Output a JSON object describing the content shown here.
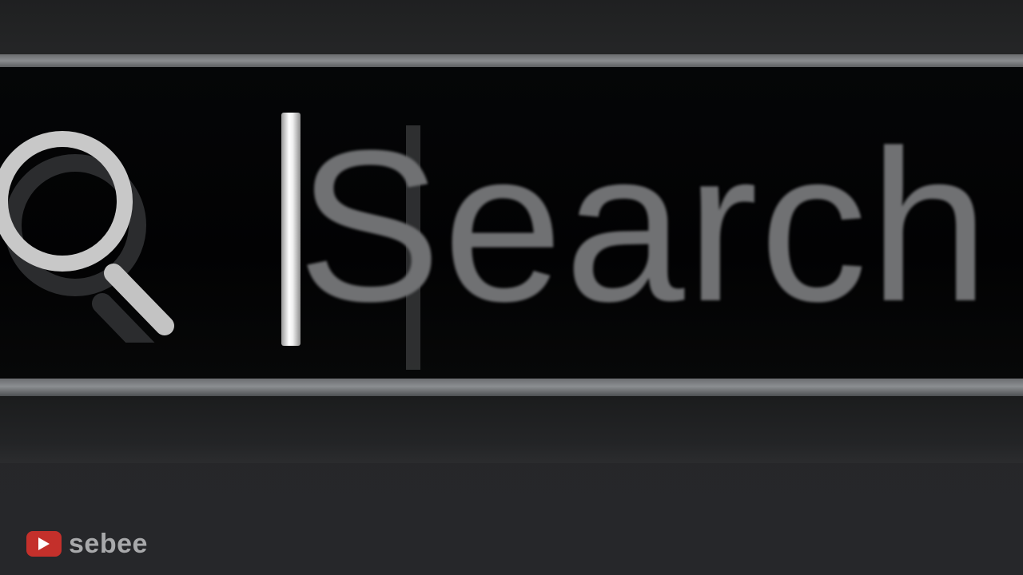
{
  "search": {
    "placeholder": "Search",
    "value": ""
  },
  "icons": {
    "search": "search-icon",
    "watermark_logo": "play-icon"
  },
  "watermark": {
    "channel_name": "sebee"
  },
  "colors": {
    "bar_background": "#030304",
    "border": "#85878a",
    "placeholder_text": "#707173",
    "caret": "#ffffff",
    "logo_red": "#c4302b"
  }
}
